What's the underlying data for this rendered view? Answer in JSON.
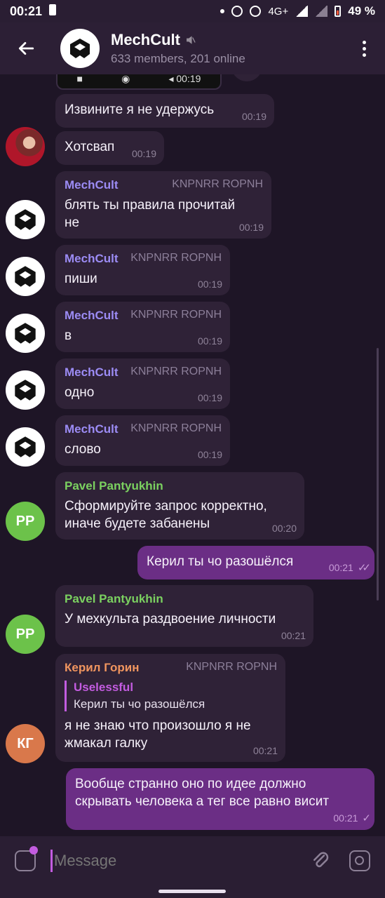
{
  "status_bar": {
    "time": "00:21",
    "network": "4G+",
    "battery": "49 %"
  },
  "header": {
    "back_icon": "arrow-left-icon",
    "title": "MechCult",
    "subtitle": "633 members, 201 online",
    "menu_icon": "more-vertical-icon"
  },
  "video_time": "00:19",
  "messages": [
    {
      "text": "Извините я не удержусь",
      "time": "00:19"
    },
    {
      "text": "Хотсвап",
      "time": "00:19"
    },
    {
      "sender": "MechCult",
      "tag": "KNPNRR ROPNH",
      "text_line1": "блять ты правила прочитай",
      "text_line2": "не",
      "time": "00:19"
    },
    {
      "sender": "MechCult",
      "tag": "KNPNRR ROPNH",
      "text": "пиши",
      "time": "00:19"
    },
    {
      "sender": "MechCult",
      "tag": "KNPNRR ROPNH",
      "text": "в",
      "time": "00:19"
    },
    {
      "sender": "MechCult",
      "tag": "KNPNRR ROPNH",
      "text": "одно",
      "time": "00:19"
    },
    {
      "sender": "MechCult",
      "tag": "KNPNRR ROPNH",
      "text": "слово",
      "time": "00:19"
    },
    {
      "sender": "Pavel Pantyukhin",
      "avatar": "PP",
      "text_line1": "Сформируйте запрос корректно,",
      "text_line2": "иначе будете забанены",
      "time": "00:20"
    },
    {
      "outgoing": true,
      "text": "Керил ты чо разошёлся",
      "time": "00:21",
      "status": "✓✓"
    },
    {
      "sender": "Pavel Pantyukhin",
      "avatar": "PP",
      "text": "У мехкульта раздвоение личности",
      "time": "00:21"
    },
    {
      "sender": "Керил Горин",
      "avatar": "КГ",
      "tag": "KNPNRR ROPNH",
      "reply_name": "Uselessful",
      "reply_text": "Керил ты чо разошёлся",
      "text_line1": "я не знаю что произошло я не",
      "text_line2": "жмакал галку",
      "time": "00:21"
    },
    {
      "outgoing": true,
      "text_line1": "Вообще странно оно по идее должно",
      "text_line2": "скрывать человека а тег все равно висит",
      "time": "00:21",
      "status": "✓"
    }
  ],
  "composer": {
    "placeholder": "Message"
  },
  "colors": {
    "accent": "#c35ce0",
    "outgoing": "#6b2e85",
    "incoming": "#2f2237",
    "pavel": "#7bd160",
    "keril": "#f0955f",
    "mechcult": "#9c8cf5"
  }
}
